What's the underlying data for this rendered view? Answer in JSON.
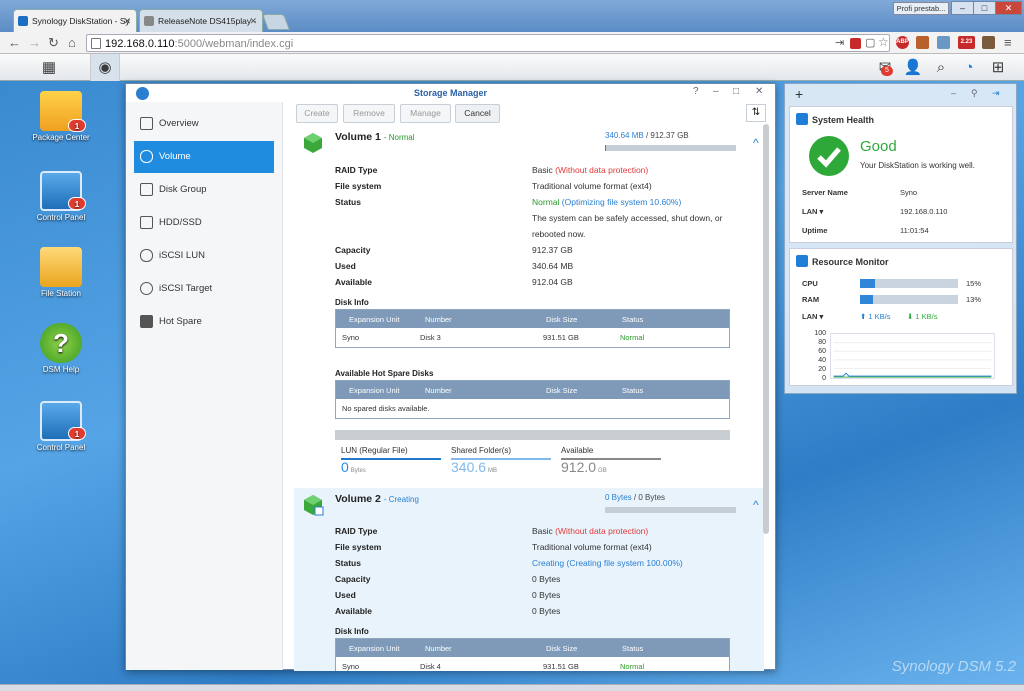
{
  "browser": {
    "tabs": [
      {
        "label": "Synology DiskStation - Sy"
      },
      {
        "label": "ReleaseNote DS415play -"
      }
    ],
    "profile": "Profi prestab...",
    "url_host": "192.168.0.110",
    "url_port": ":5000/webman/index.cgi",
    "ext_badge": "2.23"
  },
  "taskbar": {
    "notif_count": "5"
  },
  "desktop": {
    "icons": [
      {
        "label": "Package Center",
        "badge": "1"
      },
      {
        "label": "Control Panel",
        "badge": "1"
      },
      {
        "label": "File Station"
      },
      {
        "label": "DSM Help"
      },
      {
        "label": "Control Panel",
        "badge": "1"
      }
    ],
    "brand": "Synology DSM 5.2"
  },
  "window": {
    "title": "Storage Manager",
    "sidebar": [
      "Overview",
      "Volume",
      "Disk Group",
      "HDD/SSD",
      "iSCSI LUN",
      "iSCSI Target",
      "Hot Spare"
    ],
    "buttons": [
      "Create",
      "Remove",
      "Manage",
      "Cancel"
    ],
    "volume1": {
      "name": "Volume 1",
      "state": "- Normal",
      "used": "340.64 MB",
      "total": "/ 912.37 GB",
      "used_fraction": 0.0004,
      "raid_label": "RAID Type",
      "raid": "Basic",
      "raid_note": "(Without data protection)",
      "fs_label": "File system",
      "fs": "Traditional volume format (ext4)",
      "status_label": "Status",
      "status": "Normal",
      "status_note": "(Optimizing file system 10.60%)",
      "status_line2": "The system can be safely accessed, shut down, or",
      "status_line3": "rebooted now.",
      "capacity_label": "Capacity",
      "capacity": "912.37 GB",
      "used_label": "Used",
      "used_val": "340.64 MB",
      "avail_label": "Available",
      "avail": "912.04 GB",
      "disk_info": "Disk Info",
      "table_headers": [
        "Expansion Unit",
        "Number",
        "Disk Size",
        "Status"
      ],
      "disk_row": [
        "Syno",
        "Disk 3",
        "931.51 GB",
        "Normal"
      ],
      "hotspare_title": "Available Hot Spare Disks",
      "hotspare_empty": "No spared disks available.",
      "summary": [
        {
          "label": "LUN (Regular File)",
          "value": "0",
          "unit": "Bytes"
        },
        {
          "label": "Shared Folder(s)",
          "value": "340.6",
          "unit": "MB"
        },
        {
          "label": "Available",
          "value": "912.0",
          "unit": "GB"
        }
      ]
    },
    "volume2": {
      "name": "Volume 2",
      "state": "- Creating",
      "used": "0 Bytes",
      "total": "/ 0 Bytes",
      "raid": "Basic",
      "raid_note": "(Without data protection)",
      "fs": "Traditional volume format (ext4)",
      "status": "Creating",
      "status_note": "(Creating file system 100.00%)",
      "capacity": "0 Bytes",
      "used_val": "0 Bytes",
      "avail": "0 Bytes",
      "disk_row": [
        "Syno",
        "Disk 4",
        "931.51 GB",
        "Normal"
      ]
    }
  },
  "widgets": {
    "health_title": "System Health",
    "health_status": "Good",
    "health_msg": "Your DiskStation is working well.",
    "server_name_label": "Server Name",
    "server_name": "Syno",
    "lan_label": "LAN ▾",
    "lan": "192.168.0.110",
    "uptime_label": "Uptime",
    "uptime": "11:01:54",
    "resmon_title": "Resource Monitor",
    "cpu_label": "CPU",
    "cpu": "15%",
    "cpu_fraction": 0.15,
    "ram_label": "RAM",
    "ram": "13%",
    "ram_fraction": 0.13,
    "lan_up": "1 KB/s",
    "lan_down": "1 KB/s",
    "chart_ticks": [
      "100",
      "80",
      "60",
      "40",
      "20",
      "0"
    ]
  }
}
